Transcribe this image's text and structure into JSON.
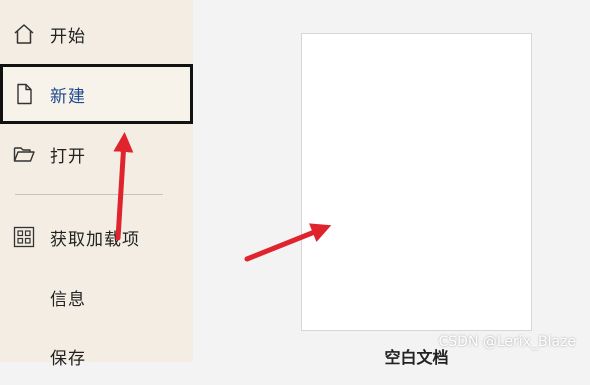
{
  "sidebar": {
    "items": [
      {
        "label": "开始",
        "icon": "home-icon"
      },
      {
        "label": "新建",
        "icon": "new-document-icon",
        "selected": true
      },
      {
        "label": "打开",
        "icon": "open-folder-icon"
      },
      {
        "label": "获取加载项",
        "icon": "add-ins-grid-icon"
      },
      {
        "label": "信息"
      },
      {
        "label": "保存"
      }
    ]
  },
  "main": {
    "template": {
      "title": "空白文档"
    }
  },
  "watermark": "CSDN @Lerix_Blaze",
  "colors": {
    "sidebar_bg": "#f3ede3",
    "main_bg": "#f3f3f3",
    "selected_text": "#1e4a8f",
    "annotation_arrow": "#e0242e"
  }
}
